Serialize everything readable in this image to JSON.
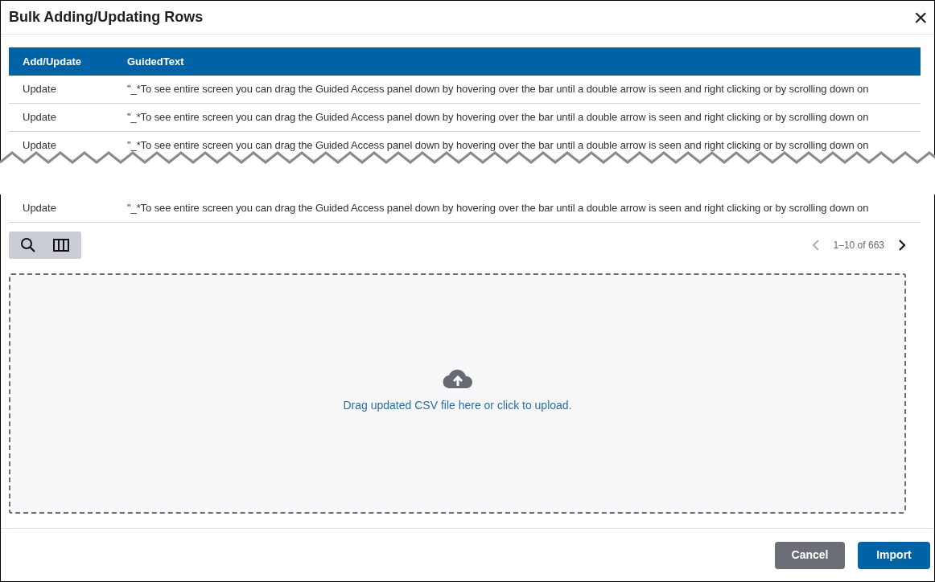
{
  "dialog": {
    "title": "Bulk Adding/Updating Rows",
    "close": "×"
  },
  "table": {
    "columns": [
      "Add/Update",
      "GuidedText"
    ],
    "rows_before_break": [
      {
        "action": "Update",
        "text": "\"_*To see entire screen you can drag the Guided Access panel down by hovering over the bar until a double arrow is seen and right clicking or by scrolling down on"
      },
      {
        "action": "Update",
        "text": "\"_*To see entire screen you can drag the Guided Access panel down by hovering over the bar until a double arrow is seen and right clicking or by scrolling down on"
      },
      {
        "action": "Update",
        "text": "\"_*To see entire screen you can drag the Guided Access panel down by hovering over the bar until a double arrow is seen and right clicking or by scrolling down on"
      }
    ],
    "rows_after_break": [
      {
        "action": "Update",
        "text": "\"_*To see entire screen you can drag the Guided Access panel down by hovering over the bar until a double arrow is seen and right clicking or by scrolling down on"
      }
    ]
  },
  "pagination": {
    "range": "1–10 of 663",
    "previous_disabled": true,
    "next_disabled": false
  },
  "dropzone": {
    "text": "Drag updated CSV file here or click to upload."
  },
  "buttons": [
    {
      "label": "Cancel",
      "kind": "secondary"
    },
    {
      "label": "Import",
      "kind": "primary"
    }
  ]
}
